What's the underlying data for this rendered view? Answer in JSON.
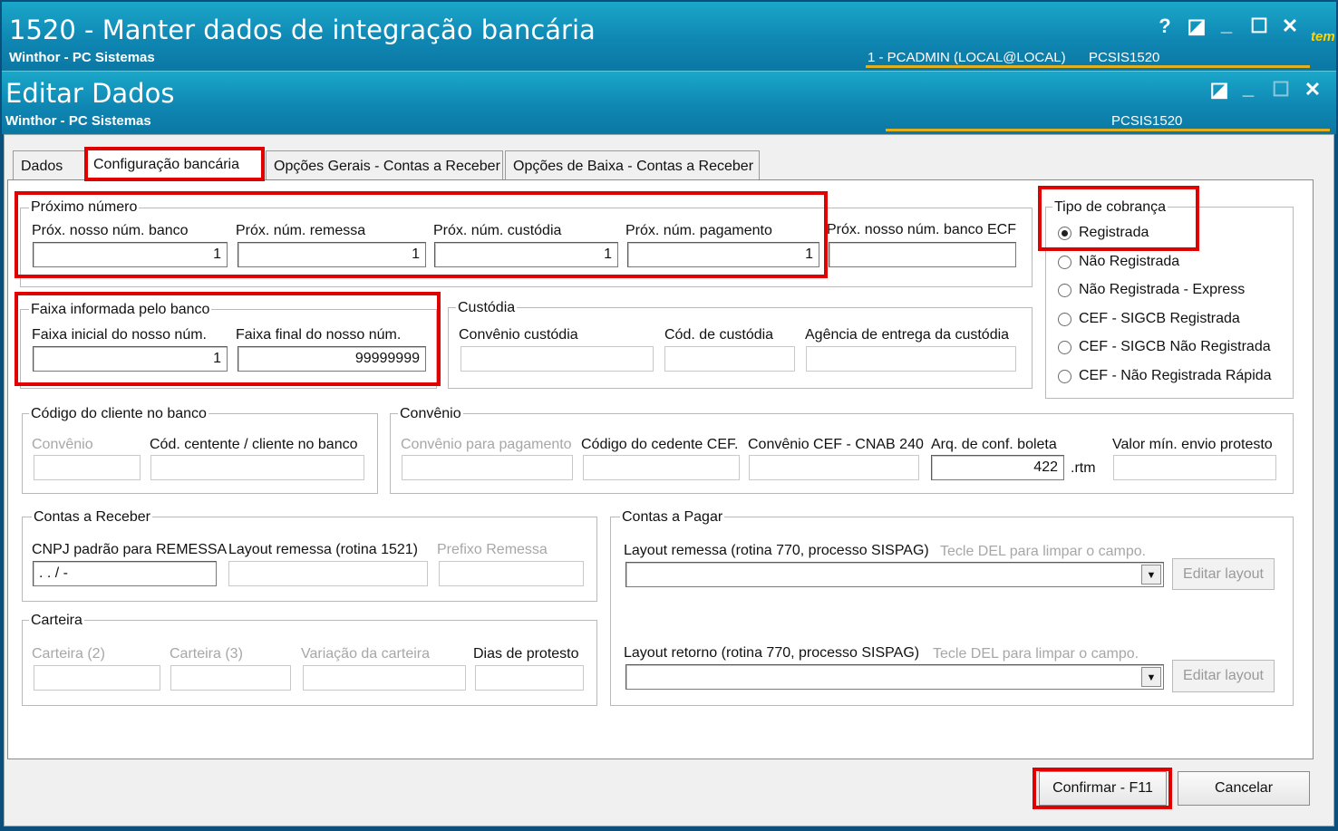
{
  "outer_window": {
    "title": "1520 - Manter dados de integração bancária",
    "subtitle": "Winthor - PC Sistemas",
    "status_user": "1 - PCADMIN (LOCAL@LOCAL)",
    "status_code": "PCSIS1520",
    "edge_text": "tem",
    "controls": {
      "help": "?",
      "restore": "◪",
      "minimize": "_",
      "maximize": "☐",
      "close": "✕"
    }
  },
  "inner_window": {
    "title": "Editar Dados",
    "subtitle": "Winthor - PC Sistemas",
    "status_code": "PCSIS1520",
    "controls": {
      "restore": "◪",
      "minimize": "_",
      "maximize": "☐",
      "close": "✕"
    }
  },
  "tabs": [
    {
      "label": "Dados"
    },
    {
      "label": "Configuração bancária"
    },
    {
      "label": "Opções Gerais - Contas a Receber"
    },
    {
      "label": "Opções de Baixa - Contas a Receber"
    }
  ],
  "proximo_numero": {
    "title": "Próximo número",
    "fields": [
      {
        "label": "Próx. nosso núm. banco",
        "value": "1"
      },
      {
        "label": "Próx. núm. remessa",
        "value": "1"
      },
      {
        "label": "Próx. núm. custódia",
        "value": "1"
      },
      {
        "label": "Próx. núm. pagamento",
        "value": "1"
      },
      {
        "label": "Próx. nosso núm. banco ECF",
        "value": ""
      }
    ]
  },
  "tipo_cobranca": {
    "title": "Tipo de cobrança",
    "options": [
      {
        "label": "Registrada",
        "selected": true
      },
      {
        "label": "Não Registrada",
        "selected": false
      },
      {
        "label": "Não Registrada - Express",
        "selected": false
      },
      {
        "label": "CEF - SIGCB Registrada",
        "selected": false
      },
      {
        "label": "CEF - SIGCB Não Registrada",
        "selected": false
      },
      {
        "label": "CEF - Não Registrada Rápida",
        "selected": false
      }
    ]
  },
  "faixa": {
    "title": "Faixa informada pelo banco",
    "inicial_label": "Faixa inicial do nosso núm.",
    "inicial_value": "1",
    "final_label": "Faixa final do nosso núm.",
    "final_value": "99999999"
  },
  "custodia": {
    "title": "Custódia",
    "convenio_label": "Convênio custódia",
    "cod_label": "Cód. de custódia",
    "agencia_label": "Agência de entrega da custódia"
  },
  "codigo_cliente": {
    "title": "Código do cliente no banco",
    "convenio_label": "Convênio",
    "cedente_label": "Cód. centente / cliente no banco"
  },
  "convenio": {
    "title": "Convênio",
    "pagamento_label": "Convênio para pagamento",
    "cedente_cef_label": "Código do cedente CEF.",
    "cnab_label": "Convênio CEF - CNAB 240",
    "arq_label": "Arq. de conf. boleta",
    "arq_value": "422",
    "arq_ext": ".rtm",
    "valor_min_label": "Valor mín. envio protesto"
  },
  "contas_receber": {
    "title": "Contas a Receber",
    "cnpj_label": "CNPJ padrão para REMESSA",
    "cnpj_mask": ".  .  /   -",
    "layout_label": "Layout remessa (rotina 1521)",
    "prefixo_label": "Prefixo Remessa"
  },
  "carteira": {
    "title": "Carteira",
    "c2_label": "Carteira (2)",
    "c3_label": "Carteira (3)",
    "variacao_label": "Variação da carteira",
    "dias_label": "Dias de protesto"
  },
  "contas_pagar": {
    "title": "Contas a Pagar",
    "remessa_label": "Layout remessa (rotina 770, processo SISPAG)",
    "retorno_label": "Layout retorno (rotina 770, processo SISPAG)",
    "hint": "Tecle DEL para limpar o campo.",
    "edit_button": "Editar layout"
  },
  "footer": {
    "confirm": "Confirmar - F11",
    "cancel": "Cancelar"
  },
  "colors": {
    "highlight": "#e00000",
    "title_bar": "#0f87b3",
    "accent_line": "#e0b020"
  }
}
